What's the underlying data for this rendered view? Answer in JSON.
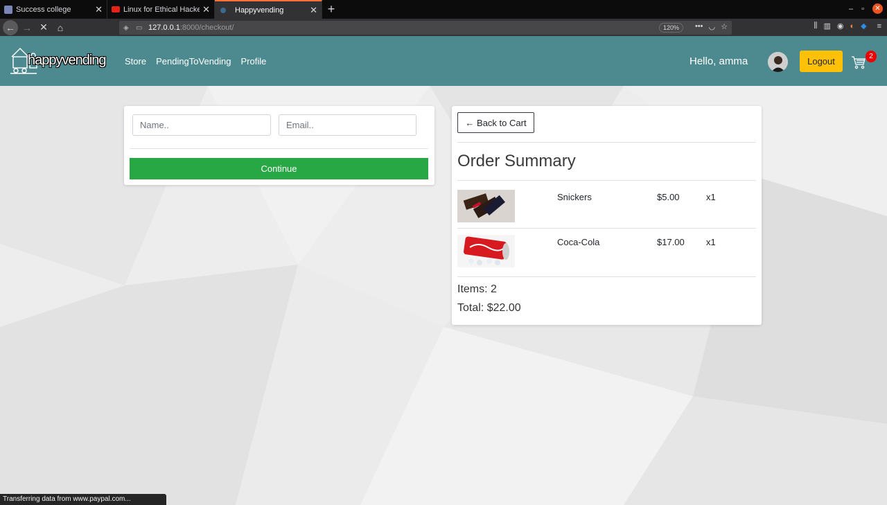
{
  "browser": {
    "tabs": [
      {
        "label": "Success college",
        "active": false
      },
      {
        "label": "Linux for Ethical Hackers",
        "active": false
      },
      {
        "label": "Happyvending",
        "active": true
      }
    ],
    "url_host": "127.0.0.1",
    "url_rest": ":8000/checkout/",
    "zoom": "120%",
    "status": "Transferring data from www.paypal.com..."
  },
  "site": {
    "logo_text": "happyvending",
    "nav": [
      "Store",
      "PendingToVending",
      "Profile"
    ],
    "greeting": "Hello, amma",
    "logout_label": "Logout",
    "cart_count": "2"
  },
  "form": {
    "name_placeholder": "Name..",
    "email_placeholder": "Email..",
    "continue_label": "Continue"
  },
  "summary": {
    "back_label": "← Back to Cart",
    "title": "Order Summary",
    "items": [
      {
        "name": "Snickers",
        "price": "$5.00",
        "qty": "x1"
      },
      {
        "name": "Coca-Cola",
        "price": "$17.00",
        "qty": "x1"
      }
    ],
    "items_line": "Items: 2",
    "total_line": "Total: $22.00"
  },
  "colors": {
    "site_nav": "#4d8a8f",
    "logout": "#ffc107",
    "continue": "#28a745",
    "badge": "#e00"
  }
}
